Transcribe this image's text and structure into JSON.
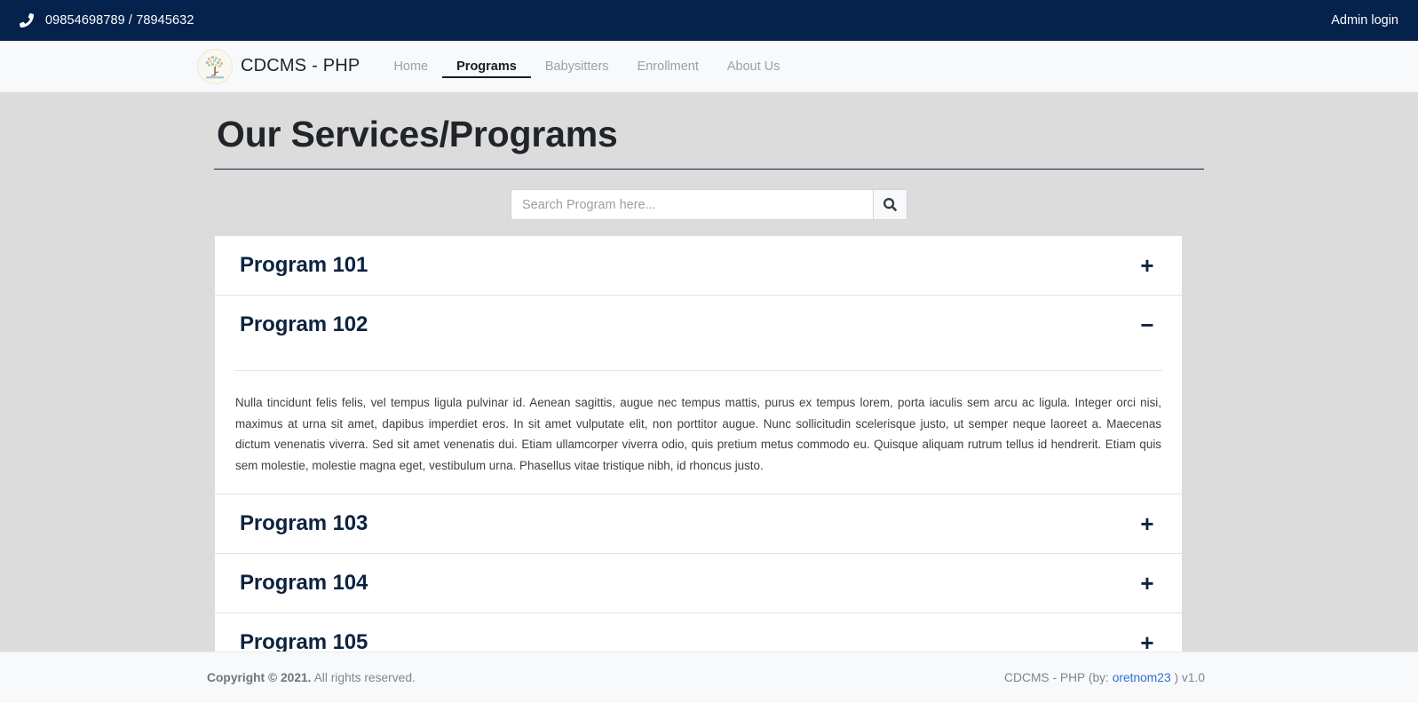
{
  "topbar": {
    "phone_icon": "phone-icon",
    "phone": "09854698789 / 78945632",
    "admin_login": "Admin login"
  },
  "navbar": {
    "logo_icon": "tree-logo-icon",
    "brand": "CDCMS - PHP",
    "links": [
      {
        "label": "Home",
        "active": false
      },
      {
        "label": "Programs",
        "active": true
      },
      {
        "label": "Babysitters",
        "active": false
      },
      {
        "label": "Enrollment",
        "active": false
      },
      {
        "label": "About Us",
        "active": false
      }
    ]
  },
  "main": {
    "page_title": "Our Services/Programs",
    "search": {
      "placeholder": "Search Program here...",
      "value": "",
      "button_icon": "search-icon"
    },
    "programs": [
      {
        "title": "Program 101",
        "toggle": "+",
        "expanded": false,
        "body": ""
      },
      {
        "title": "Program 102",
        "toggle": "−",
        "expanded": true,
        "body": "Nulla tincidunt felis felis, vel tempus ligula pulvinar id. Aenean sagittis, augue nec tempus mattis, purus ex tempus lorem, porta iaculis sem arcu ac ligula. Integer orci nisi, maximus at urna sit amet, dapibus imperdiet eros. In sit amet vulputate elit, non porttitor augue. Nunc sollicitudin scelerisque justo, ut semper neque laoreet a. Maecenas dictum venenatis viverra. Sed sit amet venenatis dui. Etiam ullamcorper viverra odio, quis pretium metus commodo eu. Quisque aliquam rutrum tellus id hendrerit. Etiam quis sem molestie, molestie magna eget, vestibulum urna. Phasellus vitae tristique nibh, id rhoncus justo."
      },
      {
        "title": "Program 103",
        "toggle": "+",
        "expanded": false,
        "body": ""
      },
      {
        "title": "Program 104",
        "toggle": "+",
        "expanded": false,
        "body": ""
      },
      {
        "title": "Program 105",
        "toggle": "+",
        "expanded": false,
        "body": ""
      }
    ]
  },
  "footer": {
    "copyright_strong": "Copyright © 2021.",
    "copyright_rest": " All rights reserved.",
    "app_prefix": "CDCMS - PHP (by: ",
    "author": "oretnom23",
    "app_suffix": " ) v1.0"
  },
  "colors": {
    "topbar_bg": "#04224c",
    "navbar_bg": "#f8f9fa",
    "page_bg": "#dcdcdc",
    "accent_navy": "#0c2340",
    "link_blue": "#2f6fd0"
  }
}
